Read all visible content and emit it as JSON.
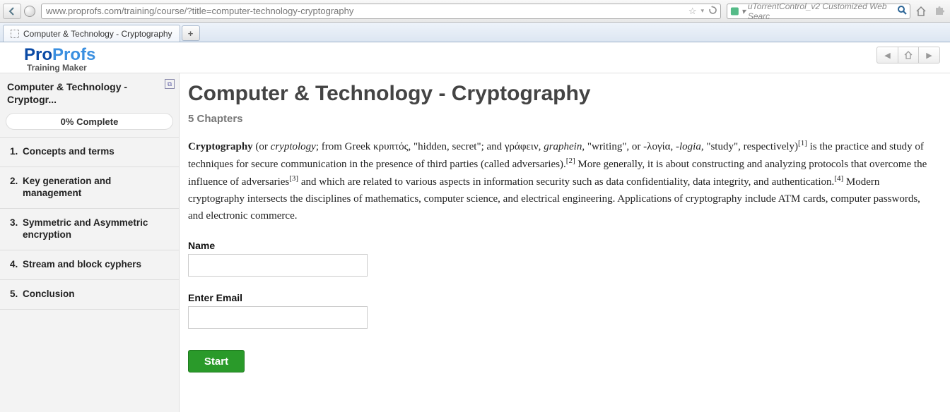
{
  "browser": {
    "url": "www.proprofs.com/training/course/?title=computer-technology-cryptography",
    "search_placeholder": "uTorrentControl_v2 Customized Web Searc",
    "tab_title": "Computer & Technology - Cryptography"
  },
  "logo": {
    "p1": "Pro",
    "p2": "Profs",
    "sub": "Training Maker"
  },
  "sidebar": {
    "title": "Computer & Technology - Cryptogr...",
    "progress": "0% Complete",
    "chapters": [
      {
        "n": "1.",
        "t": "Concepts and terms"
      },
      {
        "n": "2.",
        "t": "Key generation and management"
      },
      {
        "n": "3.",
        "t": "Symmetric and Asymmetric encryption"
      },
      {
        "n": "4.",
        "t": "Stream and block cyphers"
      },
      {
        "n": "5.",
        "t": "Conclusion"
      }
    ]
  },
  "main": {
    "title": "Computer & Technology - Cryptography",
    "chapters_line": "5 Chapters",
    "p_bold": "Cryptography",
    "p_or": " (or ",
    "p_crypt": "cryptology",
    "p_greek1": "; from Greek κρυπτός, \"hidden, secret\"; and γράφειν, ",
    "p_graphein": "graphein",
    "p_greek2": ", \"writing\", or -λογία, ",
    "p_logia": "-logia",
    "p_greek3": ", \"study\", respectively)",
    "p_after1": " is the practice and study of techniques for secure communication in the presence of third parties (called adversaries).",
    "p_after2": " More generally, it is about constructing and analyzing protocols that overcome the influence of adversaries",
    "p_after3": " and which are related to various aspects in information security such as data confidentiality, data integrity, and authentication.",
    "p_after4": " Modern cryptography intersects the disciplines of mathematics, computer science, and electrical engineering. Applications of cryptography include ATM cards, computer passwords, and electronic commerce.",
    "sup1": "[1]",
    "sup2": "[2]",
    "sup3": "[3]",
    "sup4": "[4]",
    "name_label": "Name",
    "email_label": "Enter Email",
    "start": "Start"
  }
}
